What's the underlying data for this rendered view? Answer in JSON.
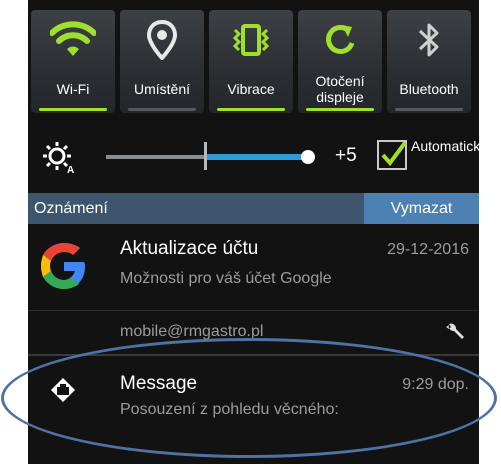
{
  "quick_settings": [
    {
      "label": "Wi-Fi",
      "icon": "wifi-icon",
      "active": true
    },
    {
      "label": "Umístění",
      "icon": "location-icon",
      "active": false
    },
    {
      "label": "Vibrace",
      "icon": "vibrate-icon",
      "active": true
    },
    {
      "label": "Otočení displeje",
      "icon": "rotate-icon",
      "active": true
    },
    {
      "label": "Bluetooth",
      "icon": "bluetooth-icon",
      "active": false
    }
  ],
  "brightness": {
    "value": "+5",
    "level": 0.85,
    "auto_label": "Automaticky",
    "auto_checked": true
  },
  "notifications": {
    "header": "Oznámení",
    "clear": "Vymazat",
    "items": [
      {
        "title": "Aktualizace účtu",
        "subtitle": "Možnosti pro váš účet Google",
        "time": "29-12-2016",
        "account": "mobile@rmgastro.pl"
      },
      {
        "title": "Message",
        "subtitle": "Posouzení z pohledu věcného:",
        "time": "9:29 dop."
      }
    ]
  },
  "colors": {
    "accent_green": "#9ee02a",
    "slider_blue": "#2f9ad8",
    "header_bg": "#3d566d",
    "clear_bg": "#4d80b3",
    "highlight": "#4e72a4"
  }
}
